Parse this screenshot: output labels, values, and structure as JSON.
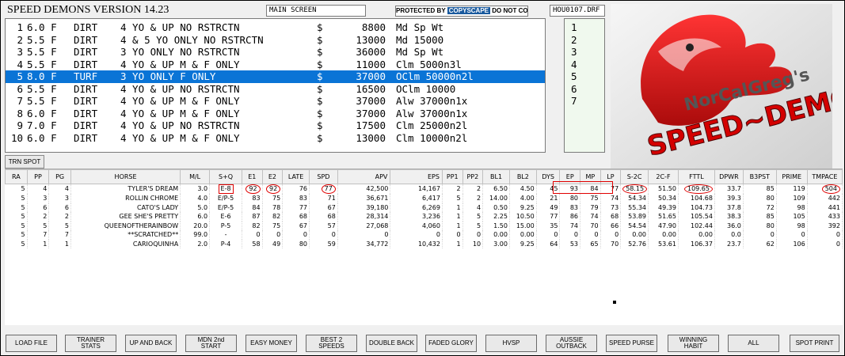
{
  "header": {
    "title": "SPEED DEMONS VERSION 14.23",
    "screen_label": "MAIN SCREEN",
    "copy_prefix": "PROTECTED BY",
    "copy_brand": "COPYSCAPE",
    "copy_suffix": "DO NOT COPY",
    "file_name": "HOU0107.DRF"
  },
  "races": [
    {
      "num": "1",
      "dist": "6.0 F",
      "surface": "DIRT",
      "conditions": "4 YO & UP NO RSTRCTN",
      "dollar": "$",
      "purse": "8800",
      "type": "Md Sp Wt"
    },
    {
      "num": "2",
      "dist": "5.5 F",
      "surface": "DIRT",
      "conditions": "4 & 5 YO ONLY NO RSTRCTN",
      "dollar": "$",
      "purse": "13000",
      "type": "Md 15000"
    },
    {
      "num": "3",
      "dist": "5.5 F",
      "surface": "DIRT",
      "conditions": "3 YO ONLY NO RSTRCTN",
      "dollar": "$",
      "purse": "36000",
      "type": "Md Sp Wt"
    },
    {
      "num": "4",
      "dist": "5.5 F",
      "surface": "DIRT",
      "conditions": "4 YO & UP M & F ONLY",
      "dollar": "$",
      "purse": "11000",
      "type": "Clm 5000n3l"
    },
    {
      "num": "5",
      "dist": "8.0 F",
      "surface": "TURF",
      "conditions": "3 YO ONLY F ONLY",
      "dollar": "$",
      "purse": "37000",
      "type": "OClm 50000n2l"
    },
    {
      "num": "6",
      "dist": "5.5 F",
      "surface": "DIRT",
      "conditions": "4 YO & UP NO RSTRCTN",
      "dollar": "$",
      "purse": "16500",
      "type": "OClm 10000"
    },
    {
      "num": "7",
      "dist": "5.5 F",
      "surface": "DIRT",
      "conditions": "4 YO & UP M & F ONLY",
      "dollar": "$",
      "purse": "37000",
      "type": "Alw 37000n1x"
    },
    {
      "num": "8",
      "dist": "6.0 F",
      "surface": "DIRT",
      "conditions": "4 YO & UP M & F ONLY",
      "dollar": "$",
      "purse": "37000",
      "type": "Alw 37000n1x"
    },
    {
      "num": "9",
      "dist": "7.0 F",
      "surface": "DIRT",
      "conditions": "4 YO & UP NO RSTRCTN",
      "dollar": "$",
      "purse": "17500",
      "type": "Clm 25000n2l"
    },
    {
      "num": "10",
      "dist": "6.0 F",
      "surface": "DIRT",
      "conditions": "4 YO & UP M & F ONLY",
      "dollar": "$",
      "purse": "13000",
      "type": "Clm 10000n2l"
    }
  ],
  "selected_race_index": 4,
  "race_numbers": [
    "1",
    "2",
    "3",
    "4",
    "5",
    "6",
    "7"
  ],
  "logo": {
    "line1": "NorCalGreg's",
    "line2": "SPEED~DEMONS"
  },
  "trn_spot_label": "TRN SPOT",
  "grid": {
    "columns": [
      "RA",
      "PP",
      "PG",
      "HORSE",
      "M/L",
      "S+Q",
      "E1",
      "E2",
      "LATE",
      "SPD",
      "APV",
      "EPS",
      "PP1",
      "PP2",
      "BL1",
      "BL2",
      "DYS",
      "EP",
      "MP",
      "LP",
      "S-2C",
      "2C-F",
      "FTTL",
      "DPWR",
      "B3PST",
      "PRIME",
      "TMPACE"
    ],
    "rows": [
      [
        "5",
        "4",
        "4",
        "TYLER'S DREAM",
        "3.0",
        "E-8",
        "92",
        "92",
        "76",
        "77",
        "42,500",
        "14,167",
        "2",
        "2",
        "6.50",
        "4.50",
        "45",
        "93",
        "84",
        "77",
        "58.15",
        "51.50",
        "109.65",
        "33.7",
        "85",
        "119",
        "504"
      ],
      [
        "5",
        "3",
        "3",
        "ROLLIN CHROME",
        "4.0",
        "E/P-5",
        "83",
        "75",
        "83",
        "71",
        "36,671",
        "6,417",
        "5",
        "2",
        "14.00",
        "4.00",
        "21",
        "80",
        "75",
        "74",
        "54.34",
        "50.34",
        "104.68",
        "39.3",
        "80",
        "109",
        "442"
      ],
      [
        "5",
        "6",
        "6",
        "CATO'S LADY",
        "5.0",
        "E/P-5",
        "84",
        "78",
        "77",
        "67",
        "39,180",
        "6,269",
        "1",
        "4",
        "0.50",
        "9.25",
        "49",
        "83",
        "79",
        "73",
        "55.34",
        "49.39",
        "104.73",
        "37.8",
        "72",
        "98",
        "441"
      ],
      [
        "5",
        "2",
        "2",
        "GEE SHE'S PRETTY",
        "6.0",
        "E-6",
        "87",
        "82",
        "68",
        "68",
        "28,314",
        "3,236",
        "1",
        "5",
        "2.25",
        "10.50",
        "77",
        "86",
        "74",
        "68",
        "53.89",
        "51.65",
        "105.54",
        "38.3",
        "85",
        "105",
        "433"
      ],
      [
        "5",
        "5",
        "5",
        "QUEENOFTHERAINBOW",
        "20.0",
        "P-5",
        "82",
        "75",
        "67",
        "57",
        "27,068",
        "4,060",
        "1",
        "5",
        "1.50",
        "15.00",
        "35",
        "74",
        "70",
        "66",
        "54.54",
        "47.90",
        "102.44",
        "36.0",
        "80",
        "98",
        "392"
      ],
      [
        "5",
        "7",
        "7",
        "**SCRATCHED**",
        "99.0",
        "-",
        "0",
        "0",
        "0",
        "0",
        "0",
        "0",
        "0",
        "0",
        "0.00",
        "0.00",
        "0",
        "0",
        "0",
        "0",
        "0.00",
        "0.00",
        "0.00",
        "0.0",
        "0",
        "0",
        "0"
      ],
      [
        "5",
        "1",
        "1",
        "CARIOQUINHA",
        "2.0",
        "P-4",
        "58",
        "49",
        "80",
        "59",
        "34,772",
        "10,432",
        "1",
        "10",
        "3.00",
        "9.25",
        "64",
        "53",
        "65",
        "70",
        "52.76",
        "53.61",
        "106.37",
        "23.7",
        "62",
        "106",
        "0"
      ]
    ]
  },
  "buttons": [
    "LOAD FILE",
    "TRAINER\nSTATS",
    "UP AND BACK",
    "MDN 2nd\nSTART",
    "EASY MONEY",
    "BEST 2\nSPEEDS",
    "DOUBLE BACK",
    "FADED GLORY",
    "HVSP",
    "AUSSIE\nOUTBACK",
    "SPEED PURSE",
    "WINNING\nHABIT",
    "ALL",
    "SPOT PRINT"
  ],
  "colors": {
    "selection": "#0a74d6",
    "highlight": "#e00000",
    "number_panel": "#f0f9ee"
  }
}
